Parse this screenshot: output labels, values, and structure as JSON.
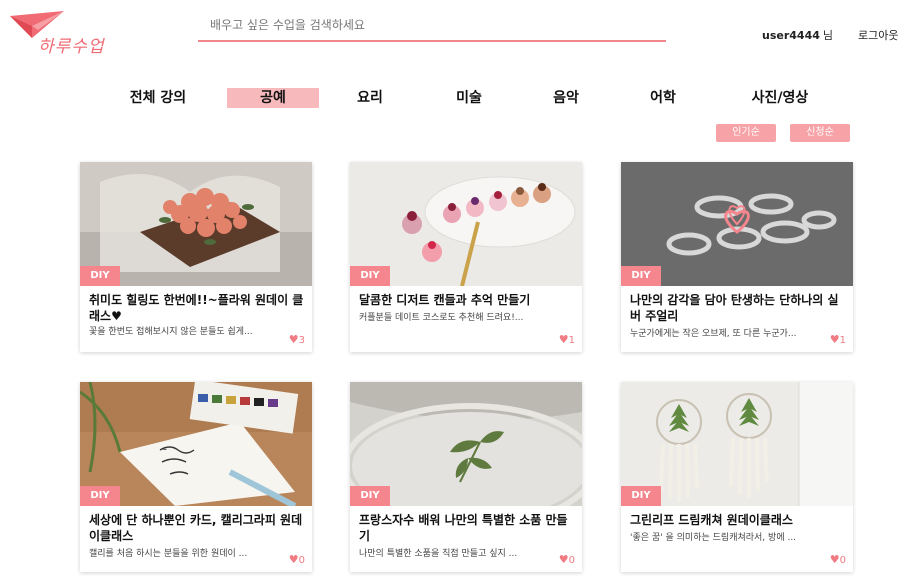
{
  "header": {
    "logo_text": "하루수업",
    "search_placeholder": "배우고 싶은 수업을 검색하세요",
    "username": "user4444",
    "username_suffix": "님",
    "logout_label": "로그아웃"
  },
  "categories": [
    "전체 강의",
    "공예",
    "요리",
    "미술",
    "음악",
    "어학",
    "사진/영상"
  ],
  "active_category": "공예",
  "sort": {
    "popular": "인기순",
    "newest": "신청순"
  },
  "cards": [
    {
      "badge": "DIY",
      "title": "취미도 힐링도 한번에!!~플라워 원데이 클래스♥",
      "desc": "꽃을 한번도 접해보시지 않은 분들도 쉽게...",
      "likes": "3"
    },
    {
      "badge": "DIY",
      "title": "달콤한 디저트 캔들과 추억 만들기",
      "desc": "커플분들 데이트 코스로도 추천해 드려요!...",
      "likes": "1"
    },
    {
      "badge": "DIY",
      "title": "나만의 감각을 담아 탄생하는 단하나의 실버 주얼리",
      "desc": "누군가에게는 작은 오브제, 또 다른 누군가...",
      "likes": "1"
    },
    {
      "badge": "DIY",
      "title": "세상에 단 하나뿐인 카드, 캘리그라피 원데이클래스",
      "desc": "캘리를 처음 하시는 분들을 위한 원데이 ...",
      "likes": "0"
    },
    {
      "badge": "DIY",
      "title": "프랑스자수 배워 나만의 특별한 소품 만들기",
      "desc": "나만의 특별한 소품을 직접 만들고 싶지 ...",
      "likes": "0"
    },
    {
      "badge": "DIY",
      "title": "그린리프 드림캐쳐 원데이클래스",
      "desc": "'좋은 꿈' 을 의미하는 드림캐쳐라서, 방에 ...",
      "likes": "0"
    }
  ],
  "colors": {
    "accent": "#f5868d",
    "active_tab": "#f8b9bd",
    "sort_button": "#f7a2a7"
  },
  "icons": {
    "like": "heart-icon",
    "logo": "paper-plane-icon"
  }
}
